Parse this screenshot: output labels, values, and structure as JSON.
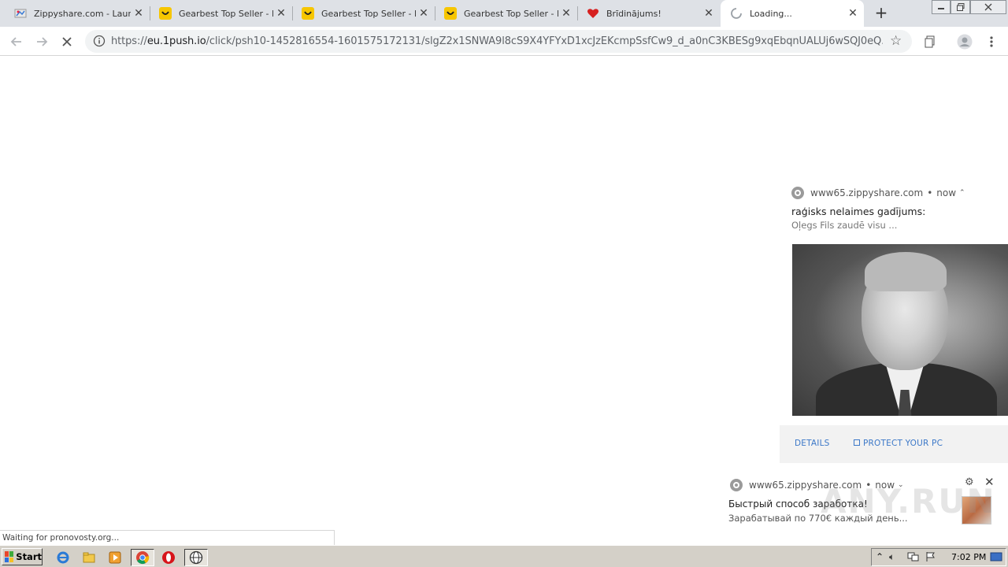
{
  "browser": {
    "tabs": [
      {
        "title": "Zippyshare.com - Launch",
        "favicon": "zippyshare-icon",
        "active": false
      },
      {
        "title": "Gearbest Top Seller - Div",
        "favicon": "gearbest-icon",
        "active": false
      },
      {
        "title": "Gearbest Top Seller - Div",
        "favicon": "gearbest-icon",
        "active": false
      },
      {
        "title": "Gearbest Top Seller - Div",
        "favicon": "gearbest-icon",
        "active": false
      },
      {
        "title": "Brīdinājums!",
        "favicon": "heart-icon",
        "active": false
      },
      {
        "title": "Loading...",
        "favicon": "loading-spinner-icon",
        "active": true
      }
    ],
    "url": {
      "scheme": "https://",
      "host": "eu.1push.io",
      "path": "/click/psh10-1452816554-1601575172131/slgZ2x1SNWA9l8cS9X4YFYxD1xcJzEKcmpSsfCw9_d_a0nC3KBESg9xqEbqnUALUj6wSQJ0eQ..."
    },
    "status": "Waiting for pronovosty.org..."
  },
  "notification_1": {
    "source": "www65.zippyshare.com",
    "separator": "•",
    "time": "now",
    "title": "raģisks nelaimes gadījums:",
    "message": "Oļegs Fils zaudē visu ...",
    "actions": {
      "details": "DETAILS",
      "protect": "PROTECT YOUR PC"
    }
  },
  "notification_2": {
    "source": "www65.zippyshare.com",
    "separator": "•",
    "time": "now",
    "title": "Быстрый способ заработка!",
    "message": "Зарабатывай по 770€ каждый день..."
  },
  "watermark": "ANY.RUN",
  "taskbar": {
    "start_label": "Start",
    "clock": "7:02 PM"
  },
  "colors": {
    "tab_strip": "#dee1e6",
    "link_blue": "#3c78c8",
    "taskbar": "#d4d0c8",
    "gearbest_yellow": "#f7c600",
    "heart_red": "#d62020"
  }
}
